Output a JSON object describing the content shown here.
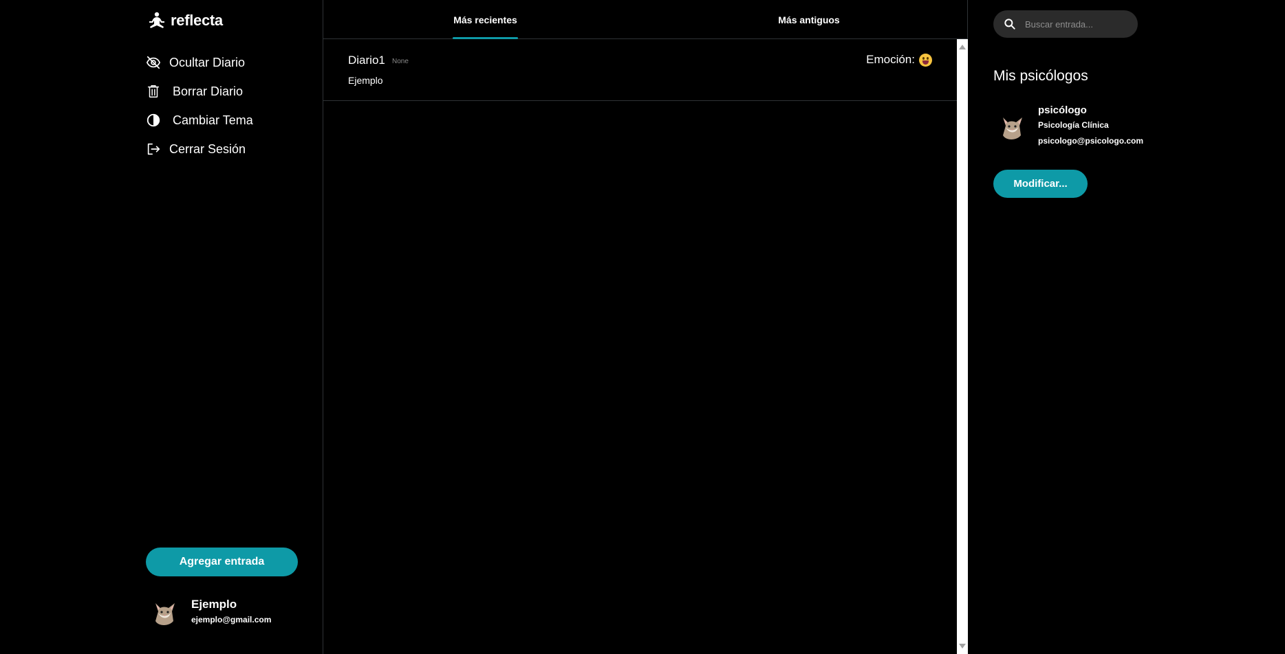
{
  "app": {
    "name": "reflecta"
  },
  "sidebar": {
    "items": [
      {
        "label": "Ocultar Diario",
        "icon": "eye-off-icon"
      },
      {
        "label": "Borrar Diario",
        "icon": "trash-icon"
      },
      {
        "label": "Cambiar Tema",
        "icon": "contrast-icon"
      },
      {
        "label": "Cerrar Sesión",
        "icon": "logout-icon"
      }
    ],
    "add_entry_label": "Agregar entrada",
    "user": {
      "name": "Ejemplo",
      "email": "ejemplo@gmail.com"
    }
  },
  "main": {
    "tabs": [
      {
        "label": "Más recientes",
        "active": true
      },
      {
        "label": "Más antiguos",
        "active": false
      }
    ],
    "entries": [
      {
        "title": "Diario1",
        "meta": "None",
        "body": "Ejemplo",
        "emotion_label": "Emoción:",
        "emotion_icon": "grinning-tongue-emoji"
      }
    ]
  },
  "right": {
    "search": {
      "placeholder": "Buscar entrada..."
    },
    "section_title": "Mis psicólogos",
    "psychologist": {
      "name": "psicólogo",
      "specialty": "Psicología Clínica",
      "email": "psicologo@psicologo.com"
    },
    "modify_label": "Modificar..."
  },
  "colors": {
    "accent": "#0e9aa7",
    "background": "#000000",
    "search_bg": "#2b2b2b"
  }
}
